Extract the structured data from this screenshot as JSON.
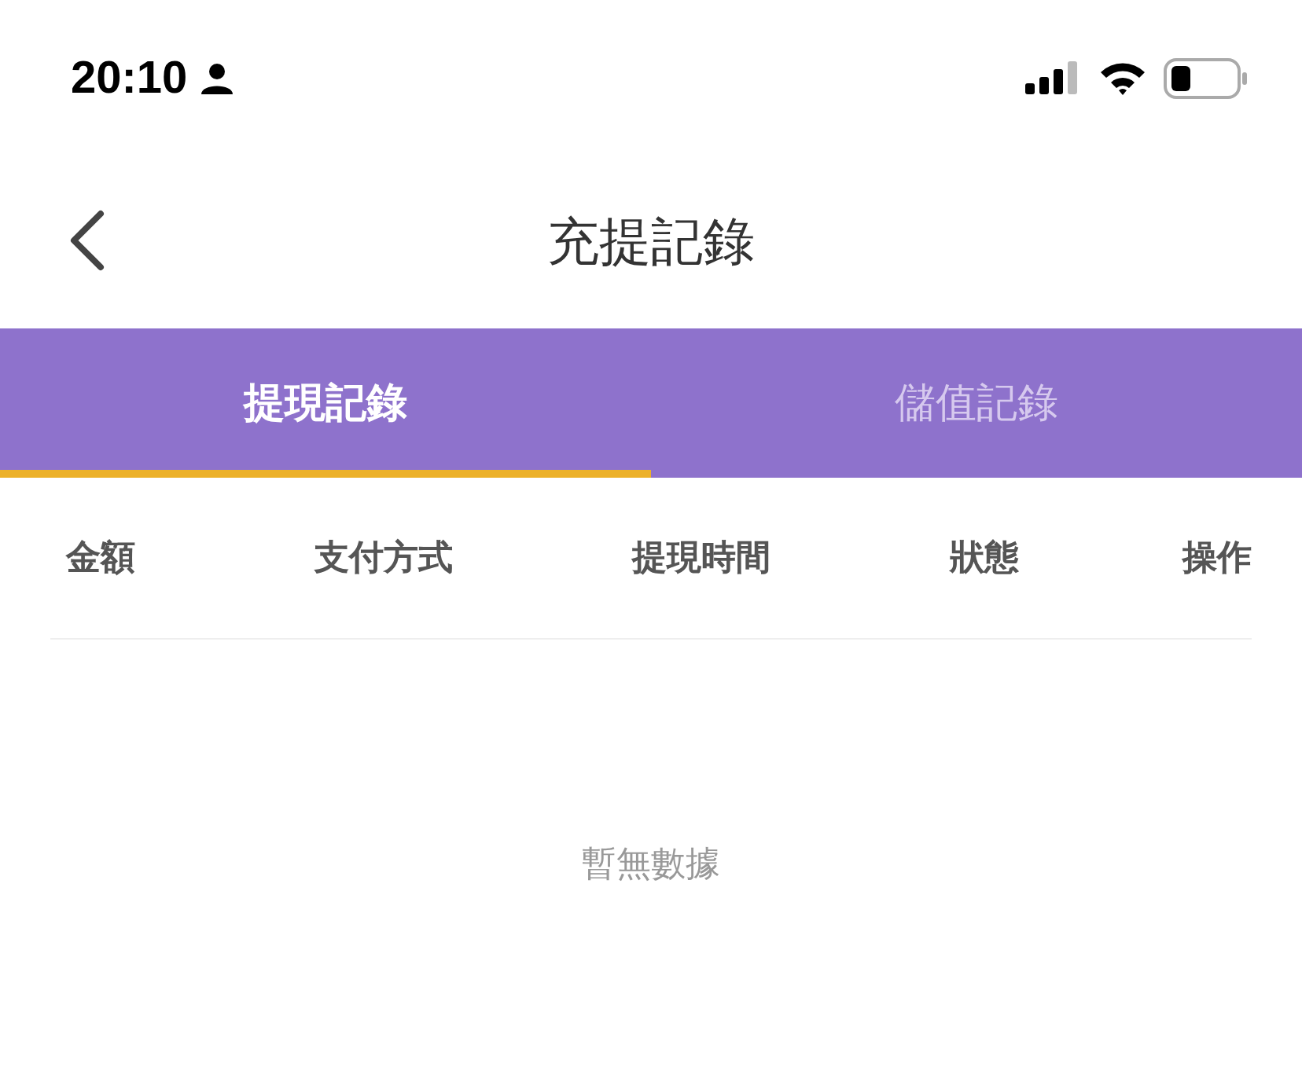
{
  "status_bar": {
    "time": "20:10"
  },
  "nav": {
    "title": "充提記錄"
  },
  "tabs": [
    {
      "label": "提現記錄",
      "selected": true
    },
    {
      "label": "儲值記錄",
      "selected": false
    }
  ],
  "table": {
    "columns": [
      "金額",
      "支付方式",
      "提現時間",
      "狀態",
      "操作"
    ],
    "empty_text": "暫無數據"
  }
}
